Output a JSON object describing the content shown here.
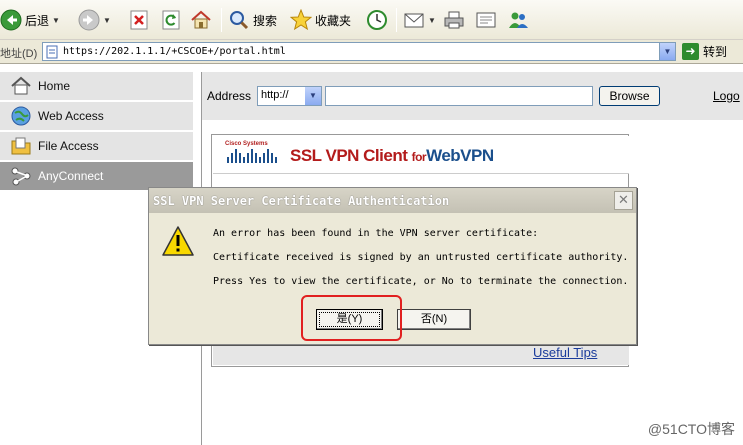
{
  "toolbar": {
    "back_label": "后退",
    "search_label": "搜索",
    "favorites_label": "收藏夹"
  },
  "addressbar": {
    "label": "地址(D)",
    "url": "https://202.1.1.1/+CSCOE+/portal.html",
    "go_label": "转到"
  },
  "sidebar": {
    "items": [
      {
        "label": "Home",
        "icon": "home-icon"
      },
      {
        "label": "Web Access",
        "icon": "globe-icon"
      },
      {
        "label": "File Access",
        "icon": "folder-icon"
      },
      {
        "label": "AnyConnect",
        "icon": "network-icon"
      }
    ],
    "active_index": 3
  },
  "main": {
    "address_label": "Address",
    "protocol": "http://",
    "url_value": "",
    "browse_label": "Browse",
    "logout_label": "Logo",
    "banner": {
      "brand": "Cisco Systems",
      "title_part1": "SSL VPN ",
      "title_part2": "Client ",
      "title_part3": "for",
      "title_part4": "WebVPN"
    },
    "useful_tips": "Useful Tips"
  },
  "dialog": {
    "title": "SSL VPN Server Certificate Authentication",
    "line1": "An error has been found in the VPN server certificate:",
    "line2": "Certificate received is signed by an untrusted certificate authority.",
    "line3": "Press Yes to view the certificate, or No to terminate the connection.",
    "yes_label": "是(Y)",
    "no_label": "否(N)"
  },
  "watermark": "@51CTO博客",
  "colors": {
    "highlight": "#e12020",
    "sidebar_active": "#9a9a9a",
    "brand_red": "#b31b1b",
    "brand_blue": "#1b4f8c"
  }
}
